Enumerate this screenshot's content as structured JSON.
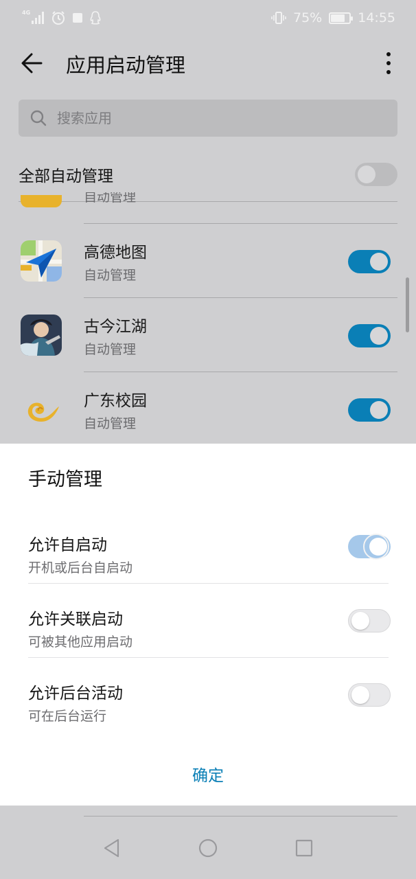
{
  "status_bar": {
    "network": "4G",
    "battery": "75%",
    "battery_level": 0.75,
    "time": "14:55"
  },
  "app_bar": {
    "title": "应用启动管理"
  },
  "search": {
    "placeholder": "搜索应用"
  },
  "all_auto": {
    "label": "全部自动管理",
    "enabled": false
  },
  "apps": [
    {
      "name": "",
      "sub": "自动管理",
      "enabled": true
    },
    {
      "name": "高德地图",
      "sub": "自动管理",
      "enabled": true
    },
    {
      "name": "古今江湖",
      "sub": "自动管理",
      "enabled": true
    },
    {
      "name": "广东校园",
      "sub": "自动管理",
      "enabled": true
    }
  ],
  "sheet": {
    "title": "手动管理",
    "options": [
      {
        "label": "允许自启动",
        "desc": "开机或后台自启动",
        "enabled": true
      },
      {
        "label": "允许关联启动",
        "desc": "可被其他应用启动",
        "enabled": false
      },
      {
        "label": "允许后台活动",
        "desc": "可在后台运行",
        "enabled": false
      }
    ],
    "confirm": "确定"
  },
  "colors": {
    "accent": "#0a7fb6",
    "scrim": "#cfcfd1",
    "sheet": "#ffffff"
  },
  "icons": [
    "signal-icon",
    "alarm-icon",
    "square-icon",
    "qq-icon",
    "vibrate-icon",
    "battery-icon",
    "back-arrow-icon",
    "more-vert-icon",
    "search-icon",
    "nav-back-icon",
    "nav-home-icon",
    "nav-recents-icon"
  ]
}
